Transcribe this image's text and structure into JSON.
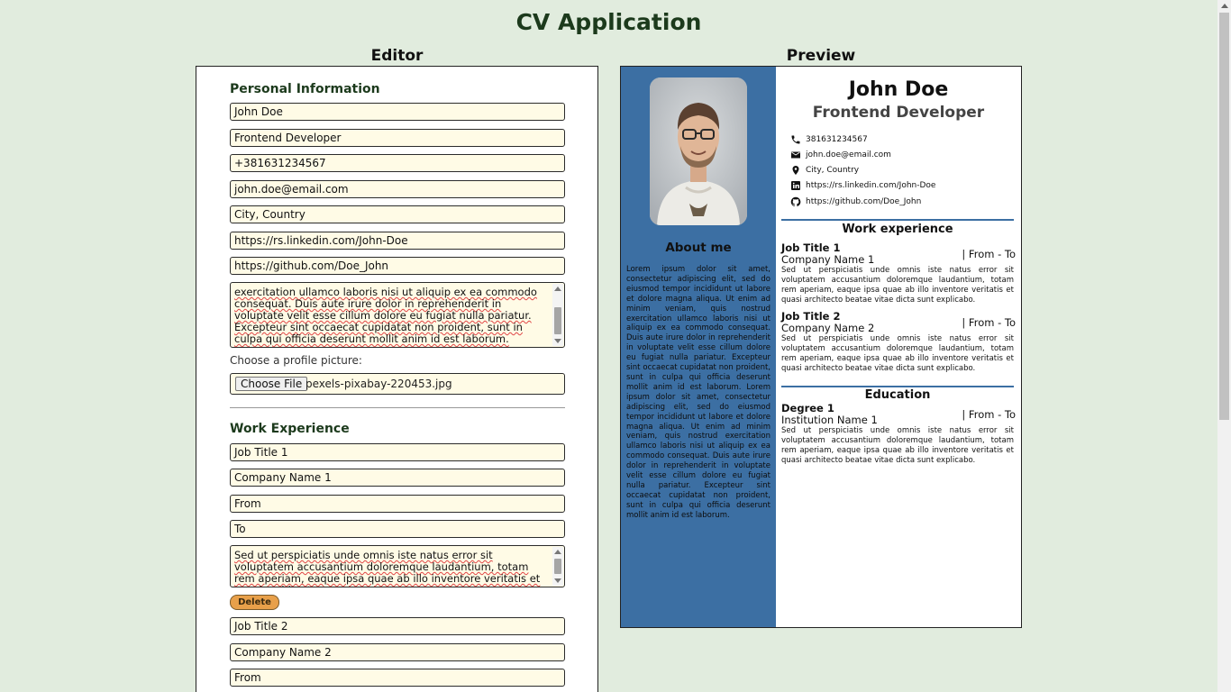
{
  "app": {
    "title": "CV Application"
  },
  "editor": {
    "heading": "Editor",
    "personal": {
      "title": "Personal Information",
      "name": "John Doe",
      "job_title": "Frontend Developer",
      "phone": "+381631234567",
      "email": "john.doe@email.com",
      "location": "City, Country",
      "linkedin": "https://rs.linkedin.com/John-Doe",
      "github": "https://github.com/Doe_John",
      "about_visible": "exercitation ullamco laboris nisi ut aliquip ex ea commodo consequat. Duis aute irure dolor in reprehenderit in voluptate velit esse cillum dolore eu fugiat nulla pariatur. Excepteur sint occaecat cupidatat non proident, sunt in culpa qui officia deserunt mollit anim id est laborum.",
      "picture_label": "Choose a profile picture:",
      "file_button": "Choose File",
      "file_name": "pexels-pixabay-220453.jpg"
    },
    "work": {
      "title": "Work Experience",
      "jobs": [
        {
          "title": "Job Title 1",
          "company": "Company Name 1",
          "from": "From",
          "to": "To",
          "desc": "Sed ut perspiciatis unde omnis iste natus error sit voluptatem accusantium doloremque laudantium, totam rem aperiam, eaque ipsa quae ab illo inventore veritatis et quasi architecto",
          "delete": "Delete"
        },
        {
          "title": "Job Title 2",
          "company": "Company Name 2",
          "from": "From"
        }
      ]
    }
  },
  "preview": {
    "heading": "Preview",
    "name": "John Doe",
    "title": "Frontend Developer",
    "about_title": "About me",
    "about": "Lorem ipsum dolor sit amet, consectetur adipiscing elit, sed do eiusmod tempor incididunt ut labore et dolore magna aliqua. Ut enim ad minim veniam, quis nostrud exercitation ullamco laboris nisi ut aliquip ex ea commodo consequat. Duis aute irure dolor in reprehenderit in voluptate velit esse cillum dolore eu fugiat nulla pariatur. Excepteur sint occaecat cupidatat non proident, sunt in culpa qui officia deserunt mollit anim id est laborum. Lorem ipsum dolor sit amet, consectetur adipiscing elit, sed do eiusmod tempor incididunt ut labore et dolore magna aliqua. Ut enim ad minim veniam, quis nostrud exercitation ullamco laboris nisi ut aliquip ex ea commodo consequat. Duis aute irure dolor in reprehenderit in voluptate velit esse cillum dolore eu fugiat nulla pariatur. Excepteur sint occaecat cupidatat non proident, sunt in culpa qui officia deserunt mollit anim id est laborum.",
    "contacts": {
      "phone": "381631234567",
      "email": "john.doe@email.com",
      "location": "City, Country",
      "linkedin": "https://rs.linkedin.com/John-Doe",
      "github": "https://github.com/Doe_John"
    },
    "work_title": "Work experience",
    "jobs": [
      {
        "title": "Job Title 1",
        "company": "Company Name 1",
        "dates": "| From - To",
        "desc": "Sed ut perspiciatis unde omnis iste natus error sit voluptatem accusantium doloremque laudantium, totam rem aperiam, eaque ipsa quae ab illo inventore veritatis et quasi architecto beatae vitae dicta sunt explicabo."
      },
      {
        "title": "Job Title 2",
        "company": "Company Name 2",
        "dates": "| From - To",
        "desc": "Sed ut perspiciatis unde omnis iste natus error sit voluptatem accusantium doloremque laudantium, totam rem aperiam, eaque ipsa quae ab illo inventore veritatis et quasi architecto beatae vitae dicta sunt explicabo."
      }
    ],
    "education_title": "Education",
    "education": [
      {
        "degree": "Degree 1",
        "institution": "Institution Name 1",
        "dates": "| From - To",
        "desc": "Sed ut perspiciatis unde omnis iste natus error sit voluptatem accusantium doloremque laudantium, totam rem aperiam, eaque ipsa quae ab illo inventore veritatis et quasi architecto beatae vitae dicta sunt explicabo."
      }
    ]
  },
  "colors": {
    "background": "#e1ecde",
    "sidebar": "#3c6fa3",
    "input_bg": "#fffbe6",
    "delete_button": "#e8a04a",
    "heading": "#1c3a1c"
  },
  "icons": [
    "phone-icon",
    "email-icon",
    "location-icon",
    "linkedin-icon",
    "github-icon"
  ]
}
